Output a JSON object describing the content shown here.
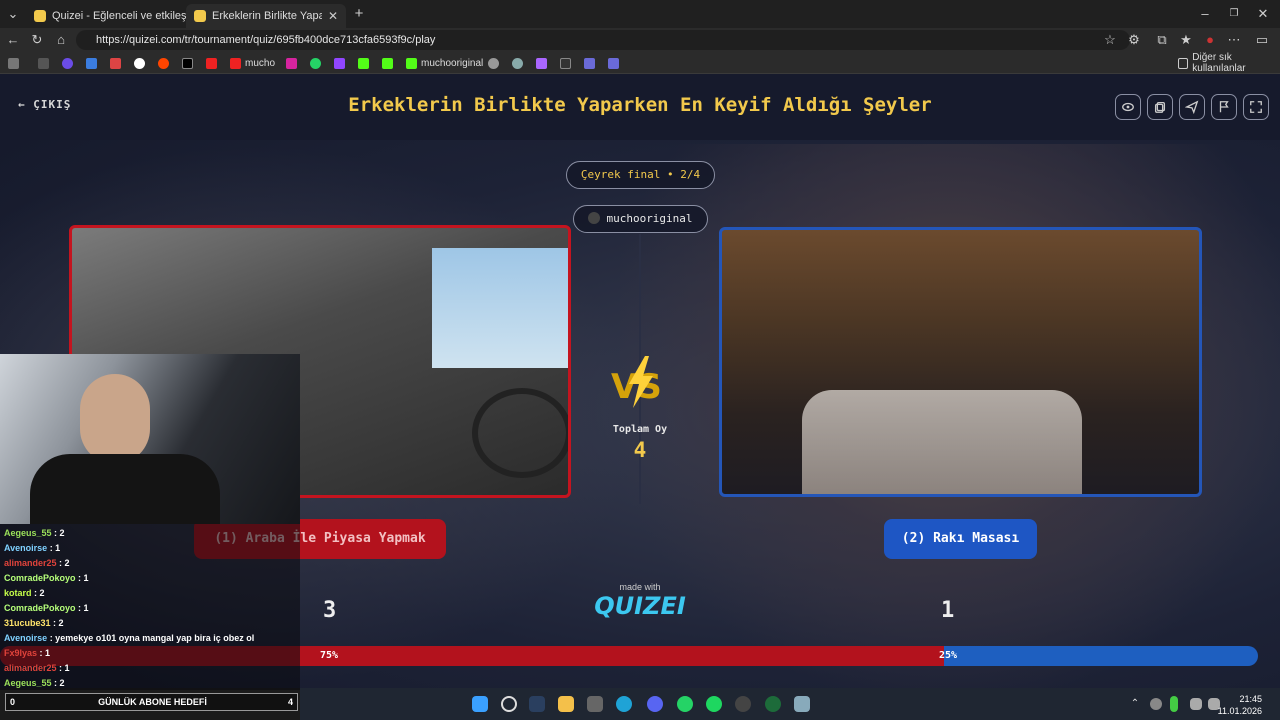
{
  "browser": {
    "tabs": [
      {
        "title": "Quizei - Eğlenceli ve etkileşimli quiz",
        "active": false
      },
      {
        "title": "Erkeklerin Birlikte Yaparken En Keyif Aldığı Şeyler",
        "active": true
      }
    ],
    "url": "https://quizei.com/tr/tournament/quiz/695fb400dce713cfa6593f9c/play",
    "bookmarks": [
      "mucho",
      "muchooriginal"
    ],
    "bookmarks_other": "Diğer sık kullanılanlar"
  },
  "header": {
    "exit_label": "ÇIKIŞ",
    "title": "Erkeklerin Birlikte Yaparken En Keyif Aldığı Şeyler"
  },
  "round": {
    "label": "Çeyrek final • 2/4",
    "creator": "muchooriginal"
  },
  "vs": {
    "total_label": "Toplam Oy",
    "total_votes": "4"
  },
  "options": [
    {
      "label": "(1) Araba İle Piyasa Yapmak",
      "votes": "3",
      "percent_label": "75%",
      "percent": 75,
      "color": "#c4141f"
    },
    {
      "label": "(2) Rakı Masası",
      "votes": "1",
      "percent_label": "25%",
      "percent": 25,
      "color": "#2456b8"
    }
  ],
  "branding": {
    "made_with": "made with",
    "logo": "QUIZEI"
  },
  "chat": [
    {
      "user": "Aegeus_55",
      "msg": " : 2",
      "color": "#9be05a"
    },
    {
      "user": "Avenoirse",
      "msg": " : 1",
      "color": "#7fd1ff"
    },
    {
      "user": "alimander25",
      "msg": " : 2",
      "color": "#e0433b"
    },
    {
      "user": "ComradePokoyo",
      "msg": " : 1",
      "color": "#b6ff7a"
    },
    {
      "user": "kotard",
      "msg": " : 2",
      "color": "#c6ff4a"
    },
    {
      "user": "ComradePokoyo",
      "msg": " : 1",
      "color": "#b6ff7a"
    },
    {
      "user": "31ucube31",
      "msg": " : 2",
      "color": "#ffe46b"
    },
    {
      "user": "Avenoirse",
      "msg": " : yemekye o101 oyna mangal yap bira iç obez ol",
      "color": "#7fd1ff"
    },
    {
      "user": "Fx9lyas",
      "msg": " : 1",
      "color": "#e0433b"
    },
    {
      "user": "alimander25",
      "msg": " : 1",
      "color": "#e0433b"
    },
    {
      "user": "Aegeus_55",
      "msg": " : 2",
      "color": "#9be05a"
    }
  ],
  "sub_goal": {
    "left": "0",
    "label": "GÜNLÜK ABONE HEDEFİ",
    "right": "4"
  },
  "clock": {
    "time": "21:45",
    "date": "11.01.2026"
  }
}
